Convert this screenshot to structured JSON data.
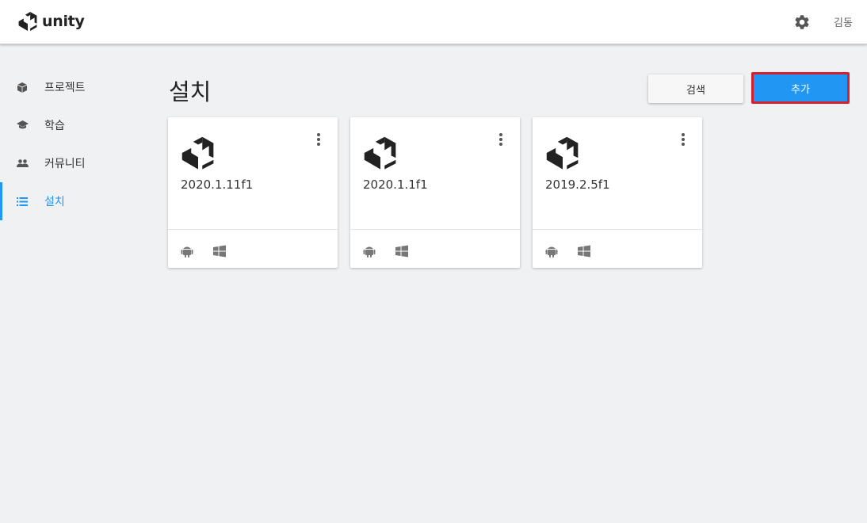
{
  "header": {
    "logo_text": "unity",
    "user_name": "김동",
    "settings_icon": "gear-icon"
  },
  "sidebar": {
    "items": [
      {
        "label": "프로젝트",
        "icon": "cube-icon",
        "active": false
      },
      {
        "label": "학습",
        "icon": "graduation-cap-icon",
        "active": false
      },
      {
        "label": "커뮤니티",
        "icon": "people-icon",
        "active": false
      },
      {
        "label": "설치",
        "icon": "list-icon",
        "active": true
      }
    ]
  },
  "main": {
    "title": "설치",
    "search_button": "검색",
    "add_button": "추가",
    "installs": [
      {
        "version": "2020.1.11f1",
        "platforms": [
          "android-icon",
          "windows-icon"
        ]
      },
      {
        "version": "2020.1.1f1",
        "platforms": [
          "android-icon",
          "windows-icon"
        ]
      },
      {
        "version": "2019.2.5f1",
        "platforms": [
          "android-icon",
          "windows-icon"
        ]
      }
    ]
  },
  "colors": {
    "accent": "#2196f3",
    "highlight_border": "#d42030",
    "background": "#f0f1f3"
  }
}
